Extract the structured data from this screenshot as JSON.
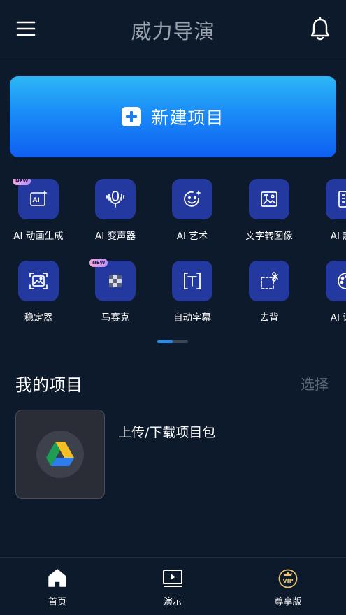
{
  "header": {
    "title": "威力导演",
    "menu_icon": "hamburger-menu-icon",
    "bell_icon": "bell-icon"
  },
  "new_project": {
    "label": "新建项目",
    "icon": "plus-square-icon"
  },
  "tools": {
    "badge_text": "NEW",
    "items": [
      {
        "label": "AI 动画生成",
        "icon": "ai-animation-icon",
        "badge": true
      },
      {
        "label": "AI 变声器",
        "icon": "voice-changer-icon",
        "badge": false
      },
      {
        "label": "AI 艺术",
        "icon": "ai-art-icon",
        "badge": false
      },
      {
        "label": "文字转图像",
        "icon": "text-to-image-icon",
        "badge": false
      },
      {
        "label": "AI 趣味",
        "icon": "ai-fun-icon",
        "badge": false
      },
      {
        "label": "稳定器",
        "icon": "stabilizer-icon",
        "badge": false
      },
      {
        "label": "马赛克",
        "icon": "mosaic-icon",
        "badge": true
      },
      {
        "label": "自动字幕",
        "icon": "auto-caption-icon",
        "badge": false
      },
      {
        "label": "去背",
        "icon": "remove-background-icon",
        "badge": false
      },
      {
        "label": "AI 语音",
        "icon": "ai-voice-icon",
        "badge": false
      }
    ],
    "page_count": 2,
    "current_page": 1
  },
  "projects": {
    "title": "我的项目",
    "select_label": "选择",
    "drive_item": {
      "label": "上传/下载项目包",
      "icon": "google-drive-icon"
    }
  },
  "bottom_nav": [
    {
      "label": "首页",
      "icon": "home-icon",
      "active": true
    },
    {
      "label": "演示",
      "icon": "play-screen-icon",
      "active": false
    },
    {
      "label": "尊享版",
      "icon": "vip-crown-icon",
      "active": false
    }
  ],
  "colors": {
    "background": "#0d1a2b",
    "accent": "#1e8ef5",
    "tile": "#2439a0",
    "muted": "#5e6874"
  }
}
